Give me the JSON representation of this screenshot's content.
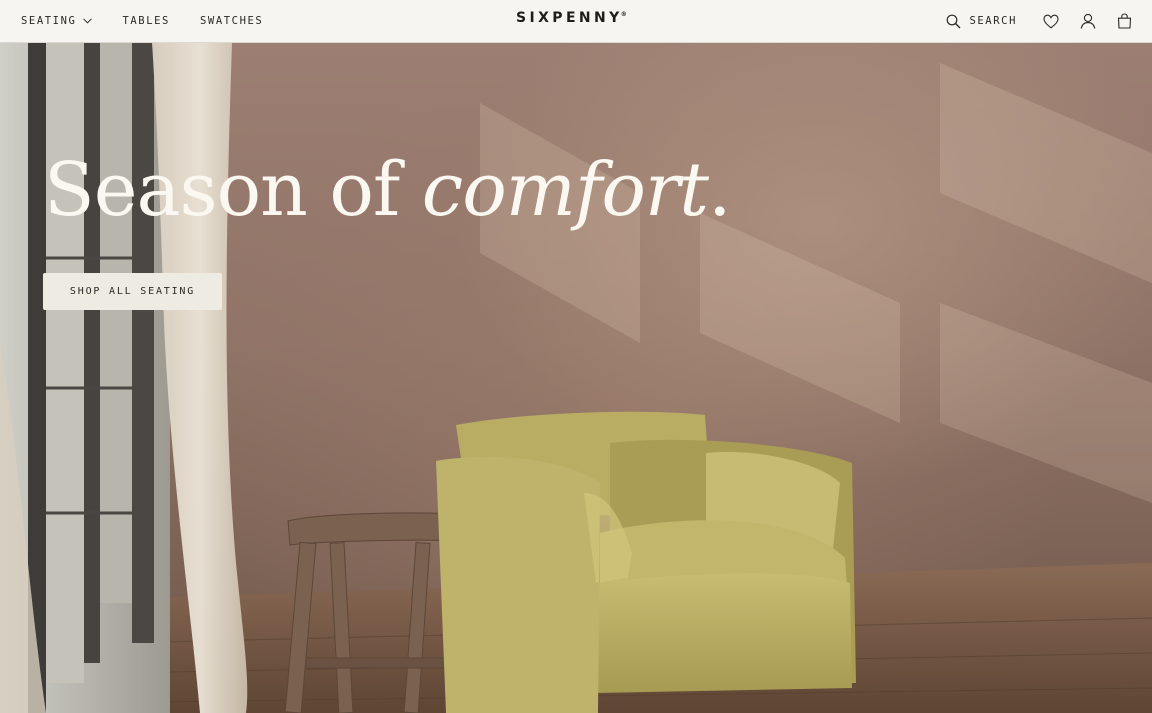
{
  "header": {
    "nav_left": [
      {
        "label": "SEATING",
        "has_dropdown": true
      },
      {
        "label": "TABLES",
        "has_dropdown": false
      },
      {
        "label": "SWATCHES",
        "has_dropdown": false
      }
    ],
    "logo": {
      "text": "SIXPENNY",
      "trademark": "®"
    },
    "search_label": "SEARCH",
    "icons": [
      "search-icon",
      "heart-icon",
      "account-icon",
      "bag-icon"
    ]
  },
  "hero": {
    "headline_regular": "Season of ",
    "headline_italic": "comfort",
    "headline_end": ".",
    "cta_label": "SHOP ALL SEATING",
    "image_subject": "yellow-armchair-and-wooden-stool"
  },
  "colors": {
    "header_bg": "#f6f5f1",
    "text_dark": "#2b2925",
    "hero_wall": "#8f7366",
    "cta_bg": "#eeebe2",
    "chair": "#b8ab62"
  }
}
